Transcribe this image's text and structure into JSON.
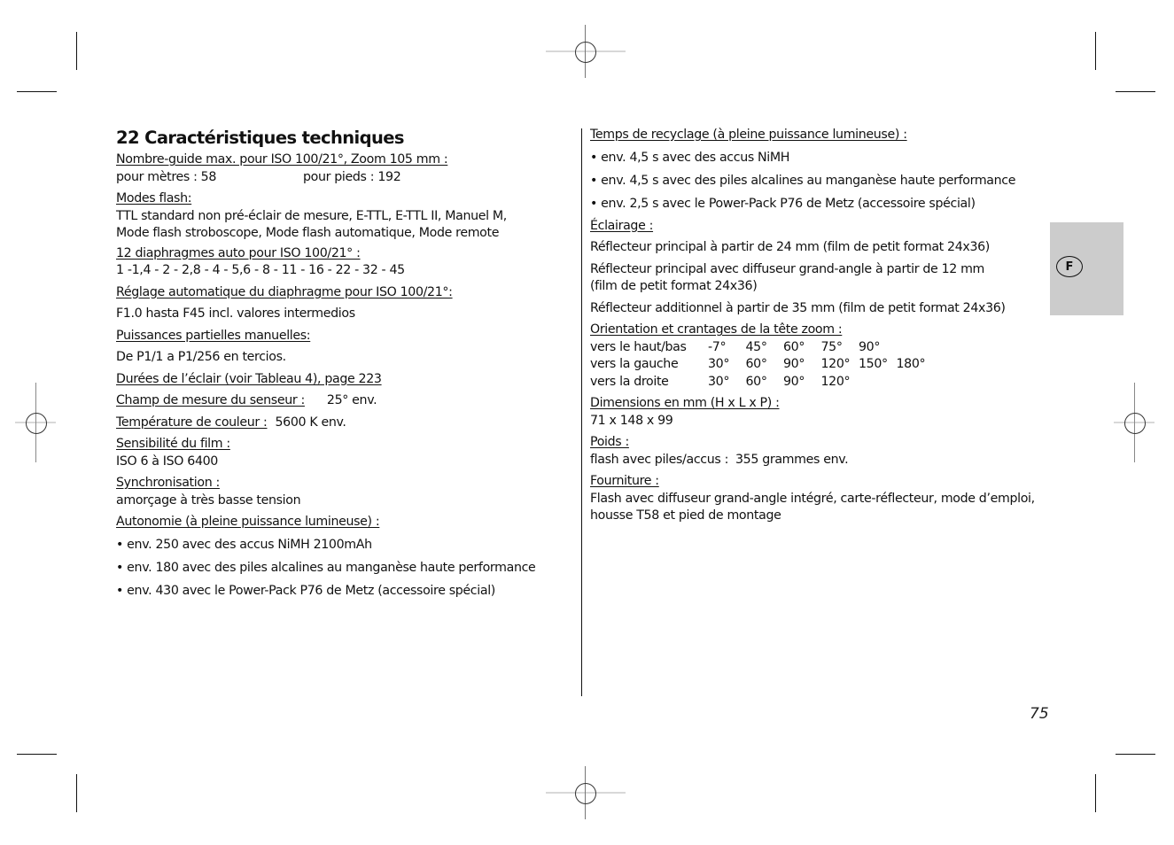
{
  "page": {
    "title": "22 Caractéristiques techniques",
    "page_number": "75",
    "language_tab": "F",
    "tab_color": "#cccccc"
  },
  "left": {
    "guide_number": {
      "heading": "Nombre-guide max. pour ISO 100/21°, Zoom 105 mm :",
      "meters": "pour mètres : 58",
      "feet": "pour pieds : 192"
    },
    "flash_modes": {
      "heading": "Modes flash:",
      "lines": [
        "TTL standard non pré-éclair de mesure, E-TTL, E-TTL II, Manuel M,",
        "Mode flash stroboscope, Mode flash automatique, Mode remote"
      ]
    },
    "apertures": {
      "heading": "12 diaphragmes auto pour ISO 100/21° :",
      "value": "1 -1,4 - 2 - 2,8 - 4 - 5,6 - 8 - 11 - 16 - 22 - 32 - 45"
    },
    "auto_aperture": {
      "heading": "Réglage automatique du diaphragme pour ISO 100/21°:",
      "value": "F1.0 hasta F45 incl. valores intermedios"
    },
    "partial_power": {
      "heading": "Puissances partielles manuelles:",
      "value": "De P1/1 a P1/256 en tercios."
    },
    "flash_durations": {
      "heading": "Durées de l’éclair (voir Tableau 4), page 223"
    },
    "sensor_field": {
      "heading": "Champ de mesure du senseur :",
      "value": "25° env."
    },
    "color_temp": {
      "heading": "Température de couleur :",
      "value": "5600 K env."
    },
    "film_speed": {
      "heading": "Sensibilité du film :",
      "value": "ISO 6 à ISO 6400"
    },
    "sync": {
      "heading": "Synchronisation :",
      "value": "amorçage à très basse tension"
    },
    "autonomy": {
      "heading": "Autonomie (à pleine puissance lumineuse) :",
      "items": [
        "• env. 250 avec des accus NiMH 2100mAh",
        "• env. 180 avec des piles alcalines au manganèse haute performance",
        "• env. 430 avec le Power-Pack P76 de Metz (accessoire spécial)"
      ]
    }
  },
  "right": {
    "recycle": {
      "heading": "Temps de recyclage (à pleine puissance lumineuse) :",
      "items": [
        "• env. 4,5 s avec des accus NiMH",
        "• env. 4,5 s avec des piles alcalines au manganèse haute performance",
        "• env. 2,5 s avec le Power-Pack P76 de Metz (accessoire spécial)"
      ]
    },
    "lighting": {
      "heading": "Éclairage :",
      "items": [
        "Réflecteur principal à partir de 24 mm (film de petit format 24x36)",
        "Réflecteur principal avec diffuseur grand-angle à partir de 12 mm",
        "(film de petit format 24x36)",
        "Réflecteur additionnel à partir de 35 mm (film de petit format 24x36)"
      ]
    },
    "orientation": {
      "heading": "Orientation et crantages de la tête zoom :",
      "rows": [
        {
          "label": "vers le haut/bas",
          "values": [
            "-7°",
            "45°",
            "60°",
            "75°",
            "90°"
          ]
        },
        {
          "label": "vers la gauche",
          "values": [
            "30°",
            "60°",
            "90°",
            "120°",
            "150°",
            "180°"
          ]
        },
        {
          "label": "vers la droite",
          "values": [
            "30°",
            "60°",
            "90°",
            "120°"
          ]
        }
      ]
    },
    "dimensions": {
      "heading": "Dimensions en mm (H x L x P) :",
      "value": "71 x 148 x 99"
    },
    "weight": {
      "heading": "Poids :",
      "label": "flash avec piles/accus :",
      "value": "355 grammes env."
    },
    "supply": {
      "heading": "Fourniture :",
      "lines": [
        "Flash avec diffuseur grand-angle intégré, carte-réflecteur, mode d’emploi,",
        "housse T58 et pied de montage"
      ]
    }
  }
}
